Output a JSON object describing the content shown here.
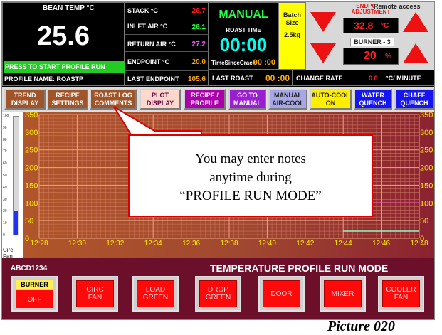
{
  "header": {
    "bean_temp_label": "BEAN TEMP °C",
    "bean_temp_value": "25.6",
    "start_banner": "PRESS TO START PROFILE RUN",
    "profile_name": "PROFILE NAME: ROASTP",
    "stack_label": "STACK °C",
    "stack_value": "26.7",
    "inlet_label": "INLET AIR °C",
    "inlet_value": "26.1",
    "return_label": "RETURN AIR °C",
    "return_value": "27.2",
    "endpoint_label": "ENDPOINT °C",
    "endpoint_value": "20.0",
    "last_endpoint_label": "LAST ENDPOINT",
    "last_endpoint_value": "105.6",
    "mode": "MANUAL",
    "roast_time_label": "ROAST TIME",
    "roast_time": "00:00",
    "time_since_crack_label": "TimeSinceCrack",
    "time_since_crack": "00 :00",
    "last_roast_label": "LAST ROAST",
    "last_roast": "00 :00",
    "batch_label": "Batch Size",
    "batch_value": "2.5kg",
    "endpoint_adj_label": "ENDPOINT ADJUSTMENT",
    "remote_access": "Remote access",
    "endpoint_adj_value": "32.8",
    "endpoint_adj_unit": "°C",
    "burner_label": "BURNER - 3",
    "burner_value": "20",
    "burner_unit": "%",
    "change_rate_label": "CHANGE RATE",
    "change_rate_value": "0.0",
    "change_rate_unit": "°C/ MINUTE"
  },
  "nav": [
    {
      "label": "TREND\nDISPLAY",
      "color": "#a0542a"
    },
    {
      "label": "RECIPE\nSETTINGS",
      "color": "#a0542a"
    },
    {
      "label": "ROAST LOG\nCOMMENTS",
      "color": "#a0542a"
    },
    {
      "label": "PLOT\nDISPLAY",
      "color": "#ffd8cc"
    },
    {
      "label": "RECIPE /\nPROFILE",
      "color": "#aa00aa"
    },
    {
      "label": "GO TO\nMANUAL",
      "color": "#9a1fd0"
    },
    {
      "label": "MANUAL\nAIR-COOL",
      "color": "#a7a7e6"
    },
    {
      "label": "AUTO-COOL\nON",
      "color": "#ffee00"
    },
    {
      "label": "WATER\nQUENCH",
      "color": "#1515ee"
    },
    {
      "label": "CHAFF\nQUENCH",
      "color": "#1515ee"
    }
  ],
  "thermometer": {
    "ticks": [
      "100",
      "90",
      "80",
      "70",
      "60",
      "50",
      "40",
      "30",
      "20",
      "10",
      "0"
    ],
    "level": 0.2,
    "label": "Circ Fan"
  },
  "chart_data": {
    "type": "line",
    "x_ticks": [
      "12:28",
      "12:30",
      "12:32",
      "12:34",
      "12:36",
      "12:38",
      "12:40",
      "12:42",
      "12:44",
      "12:46",
      "12:48"
    ],
    "ylim": [
      0,
      350
    ],
    "y_ticks": [
      "350",
      "300",
      "250",
      "200",
      "150",
      "100",
      "50",
      "0"
    ],
    "grid": true,
    "series": [
      {
        "color": "#88ffbb",
        "x": [
          "12:44",
          "12:48"
        ],
        "values": [
          20,
          20
        ]
      },
      {
        "color": "#ff66cc",
        "x": [
          "12:44",
          "12:48"
        ],
        "values": [
          100,
          100
        ]
      }
    ]
  },
  "callout": {
    "line1": "You may enter notes",
    "line2": "anytime during",
    "line3": "“PROFILE RUN MODE”"
  },
  "footer": {
    "code": "ABCD1234",
    "mode_title": "TEMPERATURE PROFILE RUN MODE",
    "burner_title": "BURNER",
    "burner_state": "OFF",
    "buttons": [
      "CIRC\nFAN",
      "LOAD\nGREEN",
      "DROP\nGREEN",
      "DOOR",
      "MIXER",
      "COOLER\nFAN"
    ]
  },
  "caption": "Picture 020"
}
